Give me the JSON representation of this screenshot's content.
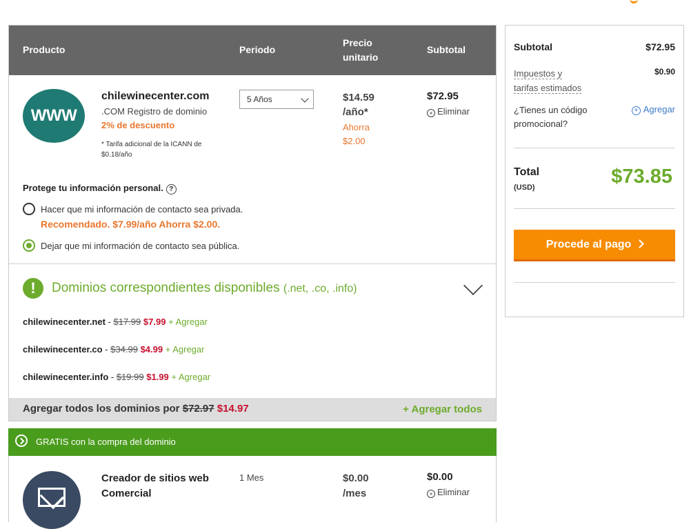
{
  "table_header": {
    "product": "Producto",
    "period": "Periodo",
    "unit_price_line1": "Precio",
    "unit_price_line2": "unitario",
    "subtotal": "Subtotal"
  },
  "item1": {
    "logo_text": "WWW",
    "domain": "chilewinecenter.com",
    "description": ".COM Registro de dominio",
    "discount": "2% de descuento",
    "note": "* Tarifa adicional de la ICANN de $0.18/año",
    "period_selected": "5 Años",
    "price_line1": "$14.59",
    "price_line2": "/año*",
    "savings_line1": "Ahorra",
    "savings_line2": "$2.00",
    "subtotal": "$72.95",
    "remove": "Eliminar"
  },
  "privacy": {
    "title": "Protege tu información personal.",
    "help": "?",
    "option_private": "Hacer que mi información de contacto sea privada.",
    "recommended": "Recomendado. $7.99/año Ahorra $2.00.",
    "option_public": "Dejar que mi información de contacto sea pública.",
    "selected": "public"
  },
  "matching": {
    "icon": "!",
    "title": "Dominios correspondientes disponibles",
    "extensions": "(.net, .co, .info)",
    "items": [
      {
        "domain": "chilewinecenter.net",
        "sep": " - ",
        "old_price": "$17.99",
        "new_price": "$7.99",
        "add": "+ Agregar"
      },
      {
        "domain": "chilewinecenter.co",
        "sep": " - ",
        "old_price": "$34.99",
        "new_price": "$4.99",
        "add": "+ Agregar"
      },
      {
        "domain": "chilewinecenter.info",
        "sep": " - ",
        "old_price": "$19.99",
        "new_price": "$1.99",
        "add": "+ Agregar"
      }
    ],
    "all_label": "Agregar todos los dominios por",
    "all_old": "$72.97",
    "all_new": "$14.97",
    "add_all": "+ Agregar todos"
  },
  "free_banner": "GRATIS con la compra del dominio",
  "item2": {
    "name": "Creador de sitios web Comercial",
    "period": "1 Mes",
    "price_line1": "$0.00",
    "price_line2": "/mes",
    "subtotal": "$0.00",
    "remove": "Eliminar"
  },
  "summary": {
    "subtotal_label": "Subtotal",
    "subtotal_value": "$72.95",
    "taxes_label_line1": "Impuestos y",
    "taxes_label_line2": "tarifas estimados",
    "taxes_value": "$0.90",
    "promo_line1": "¿Tienes un código",
    "promo_line2": "promocional?",
    "promo_add": "Agregar",
    "total_label": "Total",
    "total_currency": "(USD)",
    "total_value": "$73.85",
    "checkout": "Procede al pago"
  },
  "colors": {
    "header_bg": "#666666",
    "accent_green": "#6cab2c",
    "banner_green": "#4a9c1c",
    "orange": "#f88c00",
    "sale_red": "#c8102e",
    "discount_orange": "#e8772e"
  }
}
